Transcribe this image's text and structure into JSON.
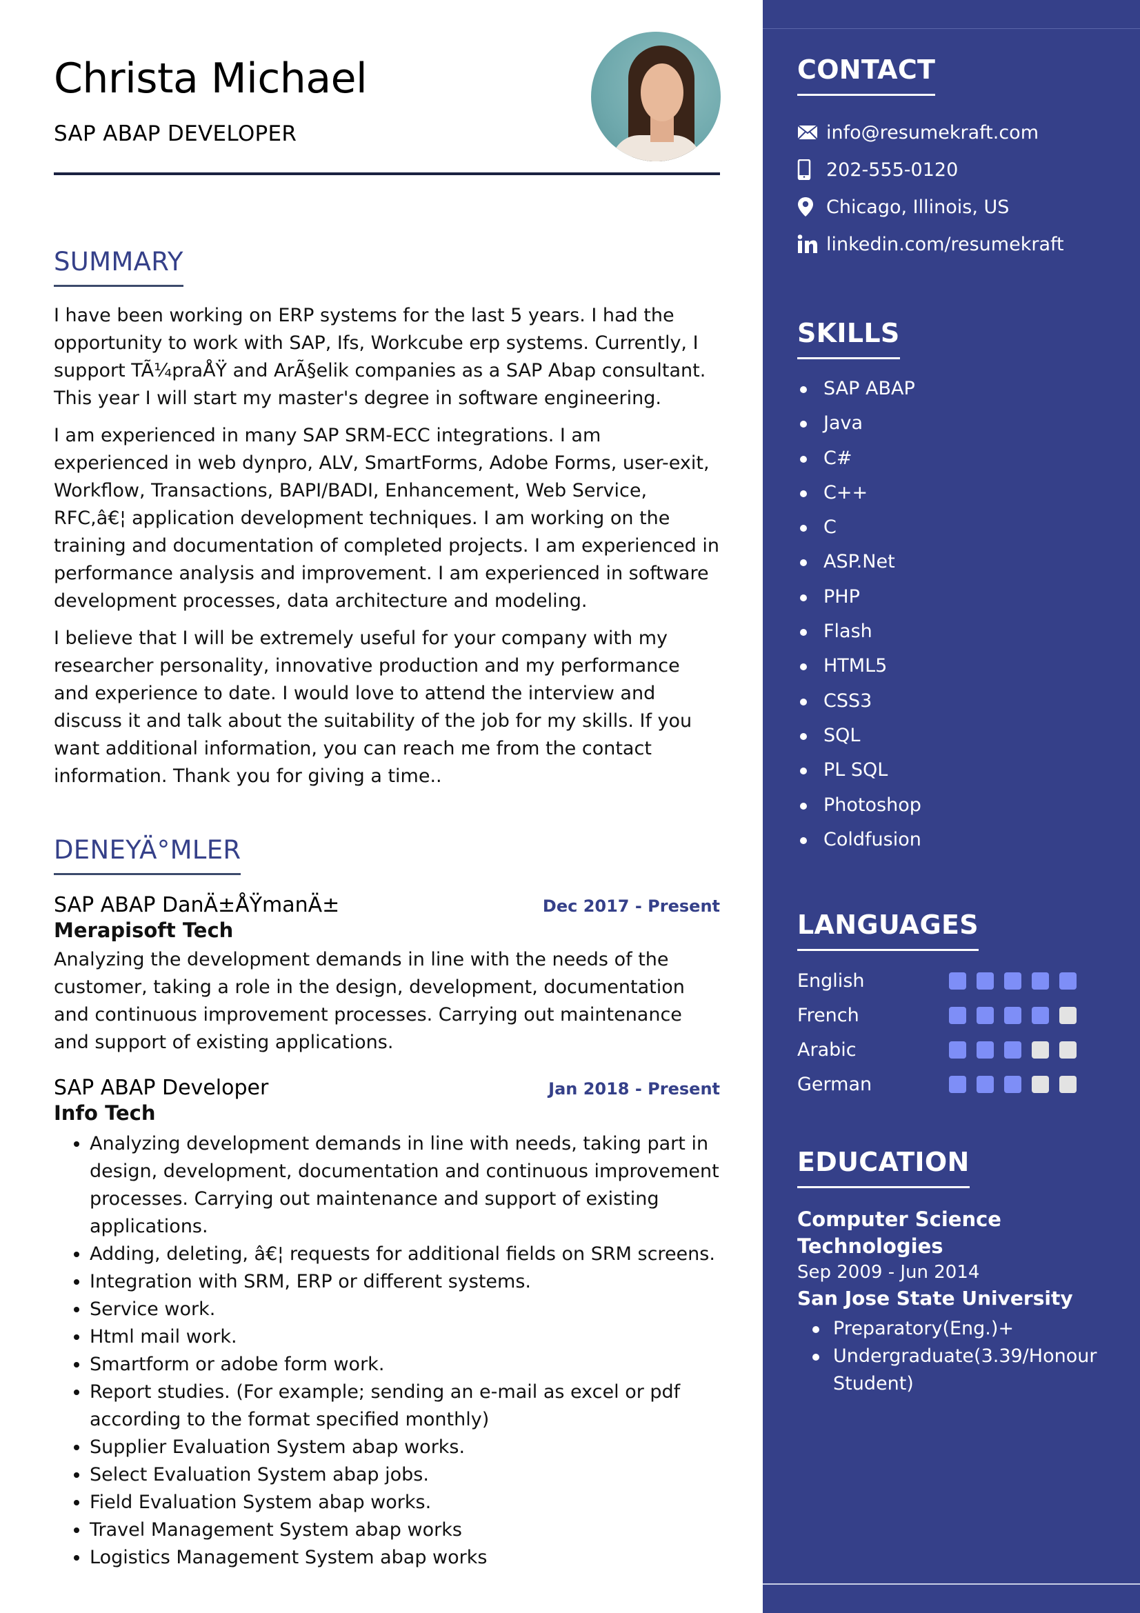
{
  "header": {
    "name": "Christa Michael",
    "title": "SAP ABAP DEVELOPER",
    "photo_alt": "profile-photo"
  },
  "summary": {
    "heading": "SUMMARY",
    "paragraphs": [
      "I have been working on ERP systems for the last 5 years. I had the opportunity to work with SAP, Ifs, Workcube erp systems. Currently, I support TÃ¼praÅŸ and ArÃ§elik companies as a SAP Abap consultant. This year I will start my master's degree in software engineering.",
      "I am experienced in many SAP SRM-ECC integrations. I am experienced in web dynpro, ALV, SmartForms, Adobe Forms, user-exit, Workflow, Transactions, BAPI/BADI, Enhancement, Web Service, RFC,â€¦ application development techniques. I am working on the training and documentation of completed projects. I am experienced in performance analysis and improvement. I am experienced in software development processes, data architecture and modeling.",
      "I believe that I will be extremely useful for your company with my researcher personality, innovative production and my performance and experience to date. I would love to attend the interview and discuss it and talk about the suitability of the job for my skills. If you want additional information, you can reach me from the contact information. Thank you for giving a time.."
    ]
  },
  "experience": {
    "heading": "DENEYÄ°MLER",
    "jobs": [
      {
        "title": "SAP ABAP DanÄ±ÅŸmanÄ±",
        "date": "Dec 2017 - Present",
        "company": "Merapisoft Tech",
        "description": "Analyzing the development demands in line with the needs of the customer, taking a role in the design, development, documentation and continuous improvement processes. Carrying out maintenance and support of existing applications."
      },
      {
        "title": "SAP ABAP Developer",
        "date": "Jan 2018 - Present",
        "company": "Info Tech",
        "bullets": [
          "Analyzing development demands in line with needs, taking part in design, development, documentation and continuous improvement processes. Carrying out maintenance and support of existing applications.",
          "Adding, deleting, â€¦ requests for additional fields on SRM screens.",
          "Integration with SRM, ERP or different systems.",
          "Service work.",
          "Html mail work.",
          "Smartform or adobe form work.",
          "Report studies. (For example; sending an e-mail as excel or pdf according to the format specified monthly)",
          "Supplier Evaluation System abap works.",
          "Select Evaluation System abap jobs.",
          "Field Evaluation System abap works.",
          "Travel Management System abap works",
          "Logistics Management System abap works"
        ]
      }
    ]
  },
  "sidebar": {
    "contact": {
      "heading": "CONTACT",
      "items": [
        {
          "icon": "envelope-icon",
          "text": "info@resumekraft.com"
        },
        {
          "icon": "mobile-phone-icon",
          "text": "202-555-0120"
        },
        {
          "icon": "map-pin-icon",
          "text": "Chicago, Illinois, US"
        },
        {
          "icon": "linkedin-icon",
          "text": "linkedin.com/resumekraft"
        }
      ]
    },
    "skills": {
      "heading": "SKILLS",
      "items": [
        "SAP ABAP",
        "Java",
        "C#",
        "C++",
        "C",
        "ASP.Net",
        "PHP",
        "Flash",
        "HTML5",
        "CSS3",
        "SQL",
        "PL SQL",
        "Photoshop",
        "Coldfusion"
      ]
    },
    "languages": {
      "heading": "LANGUAGES",
      "max_level": 5,
      "items": [
        {
          "name": "English",
          "level": 5
        },
        {
          "name": "French",
          "level": 4
        },
        {
          "name": "Arabic",
          "level": 3
        },
        {
          "name": "German",
          "level": 3
        }
      ]
    },
    "education": {
      "heading": "EDUCATION",
      "degree": "Computer Science Technologies",
      "date": "Sep 2009 - Jun 2014",
      "school": "San Jose State University",
      "details": [
        "Preparatory(Eng.)+",
        "Undergraduate(3.39/Honour Student)"
      ]
    }
  },
  "colors": {
    "sidebar_bg": "#354089",
    "accent": "#354089",
    "level_on": "#7e8ef7",
    "level_off": "#e3e3e3"
  }
}
